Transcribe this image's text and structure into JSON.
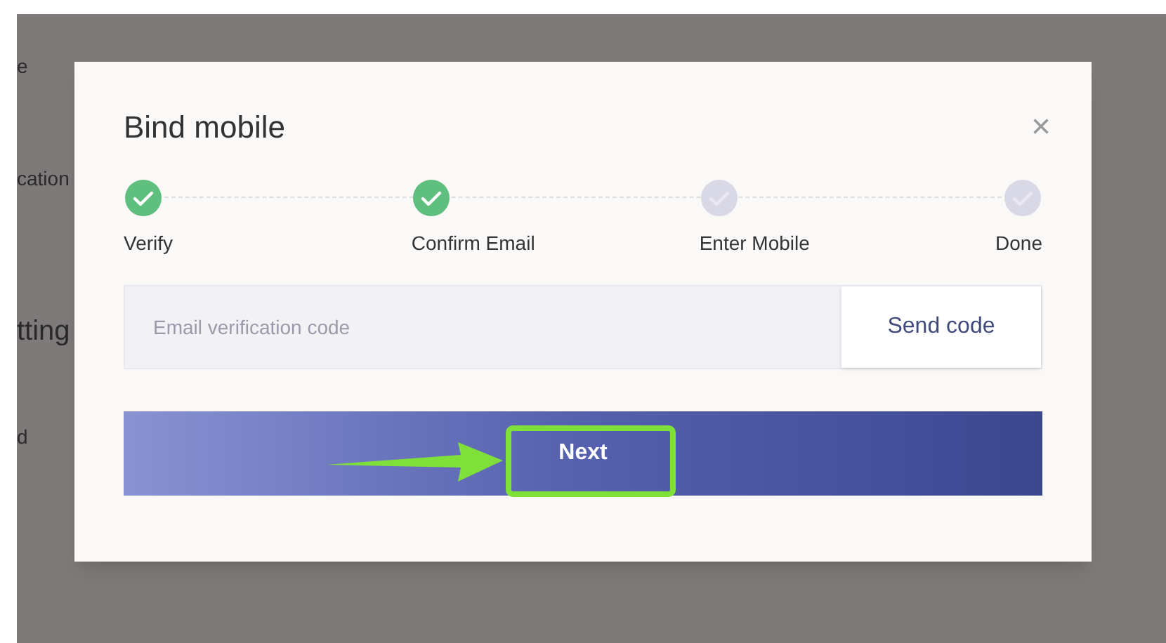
{
  "background": {
    "labels": [
      "e",
      "cation",
      "tting",
      "d"
    ]
  },
  "dialog": {
    "title": "Bind mobile",
    "close": "×",
    "steps": [
      {
        "label": "Verify",
        "done": true
      },
      {
        "label": "Confirm Email",
        "done": true
      },
      {
        "label": "Enter Mobile",
        "done": false
      },
      {
        "label": "Done",
        "done": false
      }
    ],
    "code_field": {
      "placeholder": "Email verification code"
    },
    "send_button": "Send code",
    "next_button": "Next"
  }
}
